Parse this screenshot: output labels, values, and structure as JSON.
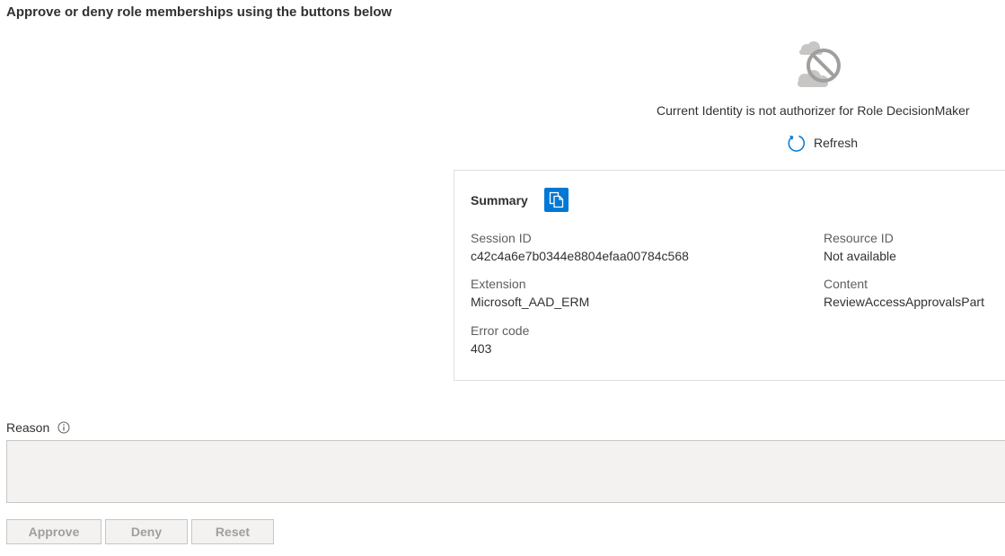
{
  "header": {
    "title": "Approve or deny role memberships using the buttons below"
  },
  "error": {
    "icon": "cloud-blocked-icon",
    "message": "Current Identity is not authorizer for Role DecisionMaker",
    "refresh_icon": "refresh-icon",
    "refresh_label": "Refresh"
  },
  "summary": {
    "heading": "Summary",
    "copy_icon": "copy-icon",
    "fields": {
      "session_id": {
        "label": "Session ID",
        "value": "c42c4a6e7b0344e8804efaa00784c568"
      },
      "resource_id": {
        "label": "Resource ID",
        "value": "Not available"
      },
      "extension": {
        "label": "Extension",
        "value": "Microsoft_AAD_ERM"
      },
      "content": {
        "label": "Content",
        "value": "ReviewAccessApprovalsPart"
      },
      "error_code": {
        "label": "Error code",
        "value": "403"
      }
    }
  },
  "reason": {
    "label": "Reason",
    "info_icon": "info-icon",
    "value": ""
  },
  "actions": {
    "approve_label": "Approve",
    "deny_label": "Deny",
    "reset_label": "Reset"
  },
  "colors": {
    "accent": "#0078d4",
    "text": "#323130",
    "secondary_text": "#605e5c",
    "disabled_text": "#a19f9d",
    "disabled_bg": "#f3f2f1",
    "border": "#c8c6c4"
  }
}
